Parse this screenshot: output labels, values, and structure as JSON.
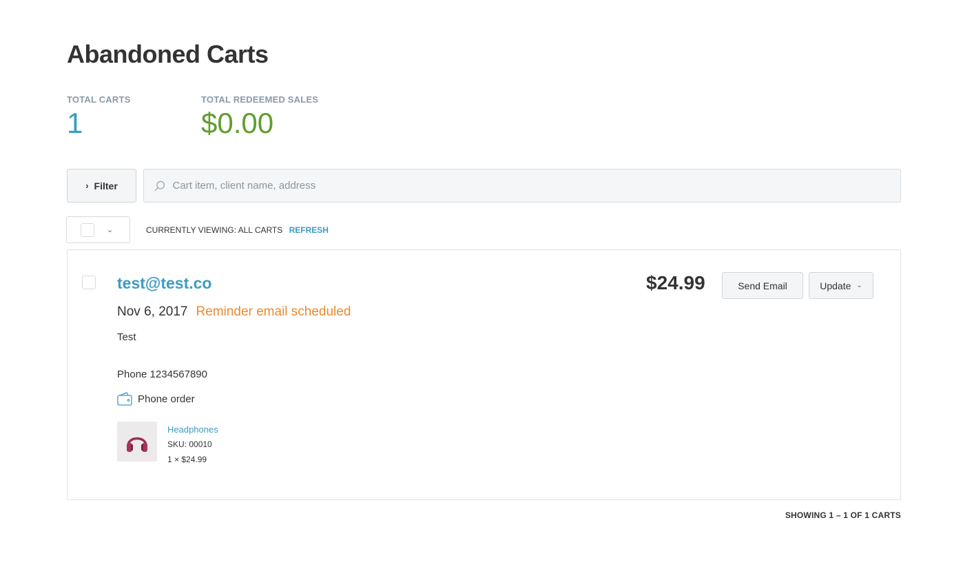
{
  "page": {
    "title": "Abandoned Carts"
  },
  "stats": {
    "total_carts_label": "TOTAL CARTS",
    "total_carts_value": "1",
    "total_sales_label": "TOTAL REDEEMED SALES",
    "total_sales_value": "$0.00"
  },
  "toolbar": {
    "filter_label": "Filter",
    "filter_icon": "chevron-right-icon",
    "search_placeholder": "Cart item, client name, address",
    "search_value": ""
  },
  "viewing": {
    "text": "CURRENTLY VIEWING: ALL CARTS",
    "refresh_label": "REFRESH"
  },
  "carts": [
    {
      "email": "test@test.co",
      "date": "Nov 6, 2017",
      "status": "Reminder email scheduled",
      "name": "Test",
      "phone": "Phone 1234567890",
      "order_type": "Phone order",
      "total": "$24.99",
      "send_email_label": "Send Email",
      "update_label": "Update",
      "items": [
        {
          "name": "Headphones",
          "sku": "SKU: 00010",
          "qty_price": "1 × $24.99",
          "icon": "headphones-icon"
        }
      ]
    }
  ],
  "pager": {
    "text": "SHOWING 1 – 1 OF 1 CARTS"
  },
  "colors": {
    "accent": "#3d9cc2",
    "sales_green": "#5e9e2f",
    "status_orange": "#e88a2e",
    "label_gray": "#8a9aa9"
  }
}
